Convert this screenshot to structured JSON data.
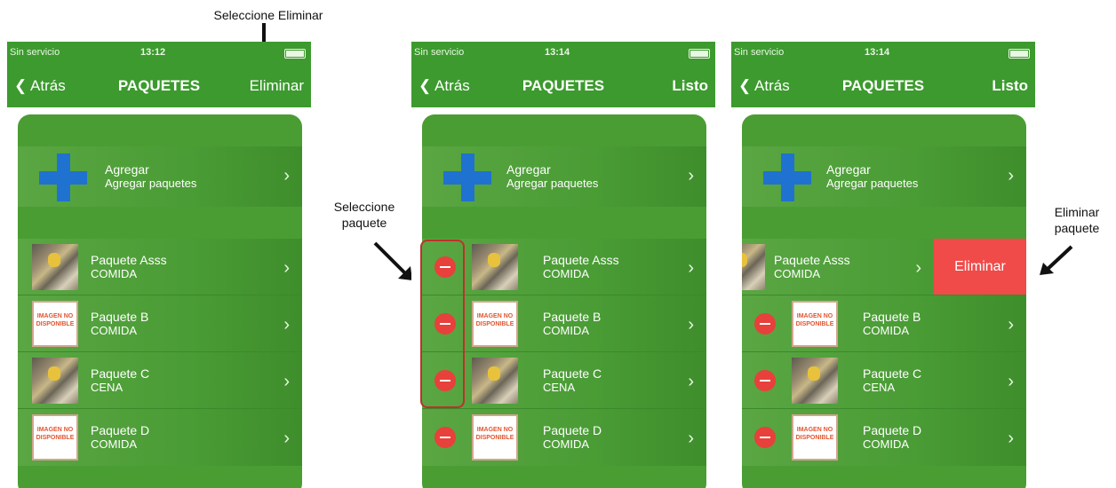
{
  "annotations": {
    "top": "Seleccione Eliminar",
    "left_line1": "Seleccione",
    "left_line2": "paquete",
    "right_line1": "Eliminar",
    "right_line2": "paquete"
  },
  "screens": [
    {
      "status": {
        "carrier": "Sin servicio",
        "time": "13:12"
      },
      "nav": {
        "back": "Atrás",
        "title": "PAQUETES",
        "action": "Eliminar"
      }
    },
    {
      "status": {
        "carrier": "Sin servicio",
        "time": "13:14"
      },
      "nav": {
        "back": "Atrás",
        "title": "PAQUETES",
        "action": "Listo"
      }
    },
    {
      "status": {
        "carrier": "Sin servicio",
        "time": "13:14"
      },
      "nav": {
        "back": "Atrás",
        "title": "PAQUETES",
        "action": "Listo"
      },
      "delete_button": "Eliminar"
    }
  ],
  "add_row": {
    "title": "Agregar",
    "subtitle": "Agregar paquetes"
  },
  "packages": [
    {
      "name": "Paquete Asss",
      "type": "COMIDA",
      "image": "food-photo"
    },
    {
      "name": "Paquete B",
      "type": "COMIDA",
      "image": "no-image"
    },
    {
      "name": "Paquete C",
      "type": "CENA",
      "image": "food-photo"
    },
    {
      "name": "Paquete D",
      "type": "COMIDA",
      "image": "no-image"
    }
  ],
  "no_image_text": "IMAGEN NO DISPONIBLE",
  "colors": {
    "green": "#3c9a2e",
    "delete_red": "#f04a49",
    "minus_red": "#e8403a",
    "plus_blue": "#1f72cf"
  }
}
